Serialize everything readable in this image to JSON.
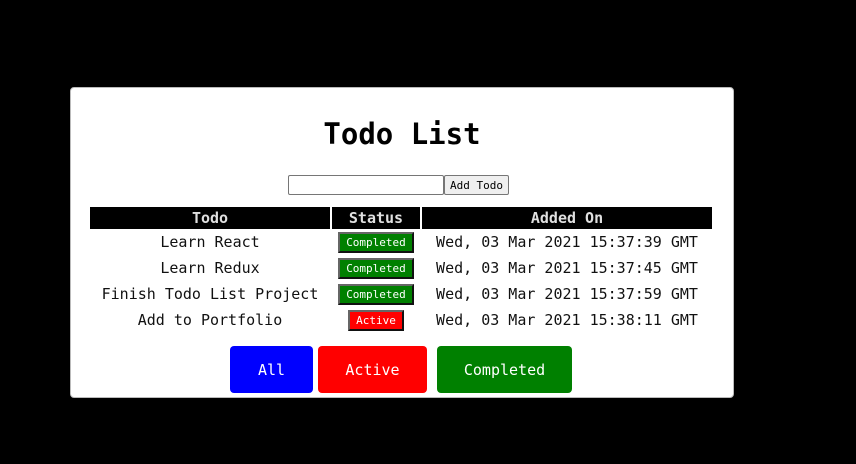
{
  "title": "Todo List",
  "add_form": {
    "input_value": "",
    "input_placeholder": "",
    "add_label": "Add Todo"
  },
  "table": {
    "headers": [
      "Todo",
      "Status",
      "Added On"
    ],
    "rows": [
      {
        "todo": "Learn React",
        "status": "Completed",
        "added_on": "Wed, 03 Mar 2021 15:37:39 GMT"
      },
      {
        "todo": "Learn Redux",
        "status": "Completed",
        "added_on": "Wed, 03 Mar 2021 15:37:45 GMT"
      },
      {
        "todo": "Finish Todo List Project",
        "status": "Completed",
        "added_on": "Wed, 03 Mar 2021 15:37:59 GMT"
      },
      {
        "todo": "Add to Portfolio",
        "status": "Active",
        "added_on": "Wed, 03 Mar 2021 15:38:11 GMT"
      }
    ]
  },
  "filters": {
    "all": "All",
    "active": "Active",
    "completed": "Completed"
  },
  "colors": {
    "completed": "#008000",
    "active": "#ff0000",
    "all": "#0000ff"
  }
}
